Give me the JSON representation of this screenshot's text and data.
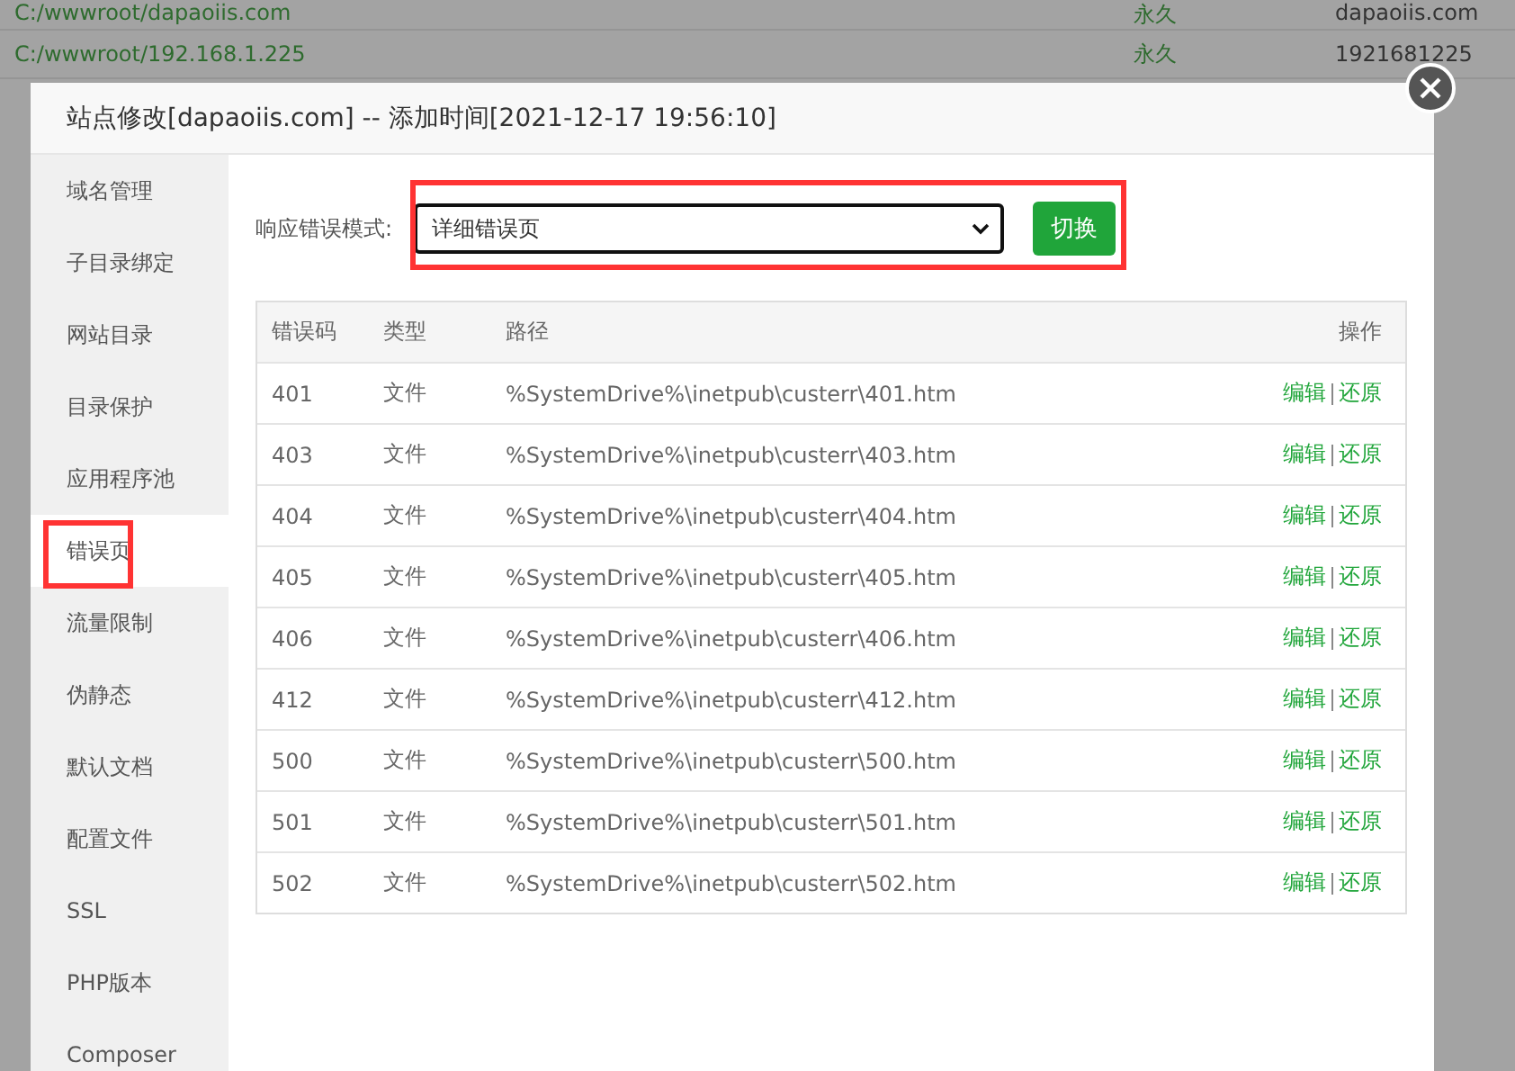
{
  "background_table": {
    "rows": [
      [
        "C:/wwwroot/dapaoiis.com",
        "永久",
        "dapaoiis.com"
      ],
      [
        "C:/wwwroot/192.168.1.225",
        "永久",
        "1921681225"
      ]
    ]
  },
  "dialog": {
    "title": "站点修改[dapaoiis.com] -- 添加时间[2021-12-17 19:56:10]",
    "sidebar": {
      "items": [
        {
          "label": "域名管理",
          "selected": false
        },
        {
          "label": "子目录绑定",
          "selected": false
        },
        {
          "label": "网站目录",
          "selected": false
        },
        {
          "label": "目录保护",
          "selected": false
        },
        {
          "label": "应用程序池",
          "selected": false
        },
        {
          "label": "错误页",
          "selected": true
        },
        {
          "label": "流量限制",
          "selected": false
        },
        {
          "label": "伪静态",
          "selected": false
        },
        {
          "label": "默认文档",
          "selected": false
        },
        {
          "label": "配置文件",
          "selected": false
        },
        {
          "label": "SSL",
          "selected": false
        },
        {
          "label": "PHP版本",
          "selected": false
        },
        {
          "label": "Composer",
          "selected": false
        }
      ]
    },
    "mode_label": "响应错误模式:",
    "mode_select": "详细错误页",
    "switch_button": "切换",
    "table": {
      "columns": [
        "错误码",
        "类型",
        "路径",
        "操作"
      ],
      "rows": [
        {
          "code": "401",
          "type": "文件",
          "path": "%SystemDrive%\\inetpub\\custerr\\401.htm",
          "actions": [
            "编辑",
            "还原"
          ]
        },
        {
          "code": "403",
          "type": "文件",
          "path": "%SystemDrive%\\inetpub\\custerr\\403.htm",
          "actions": [
            "编辑",
            "还原"
          ]
        },
        {
          "code": "404",
          "type": "文件",
          "path": "%SystemDrive%\\inetpub\\custerr\\404.htm",
          "actions": [
            "编辑",
            "还原"
          ]
        },
        {
          "code": "405",
          "type": "文件",
          "path": "%SystemDrive%\\inetpub\\custerr\\405.htm",
          "actions": [
            "编辑",
            "还原"
          ]
        },
        {
          "code": "406",
          "type": "文件",
          "path": "%SystemDrive%\\inetpub\\custerr\\406.htm",
          "actions": [
            "编辑",
            "还原"
          ]
        },
        {
          "code": "412",
          "type": "文件",
          "path": "%SystemDrive%\\inetpub\\custerr\\412.htm",
          "actions": [
            "编辑",
            "还原"
          ]
        },
        {
          "code": "500",
          "type": "文件",
          "path": "%SystemDrive%\\inetpub\\custerr\\500.htm",
          "actions": [
            "编辑",
            "还原"
          ]
        },
        {
          "code": "501",
          "type": "文件",
          "path": "%SystemDrive%\\inetpub\\custerr\\501.htm",
          "actions": [
            "编辑",
            "还原"
          ]
        },
        {
          "code": "502",
          "type": "文件",
          "path": "%SystemDrive%\\inetpub\\custerr\\502.htm",
          "actions": [
            "编辑",
            "还原"
          ]
        }
      ]
    }
  }
}
